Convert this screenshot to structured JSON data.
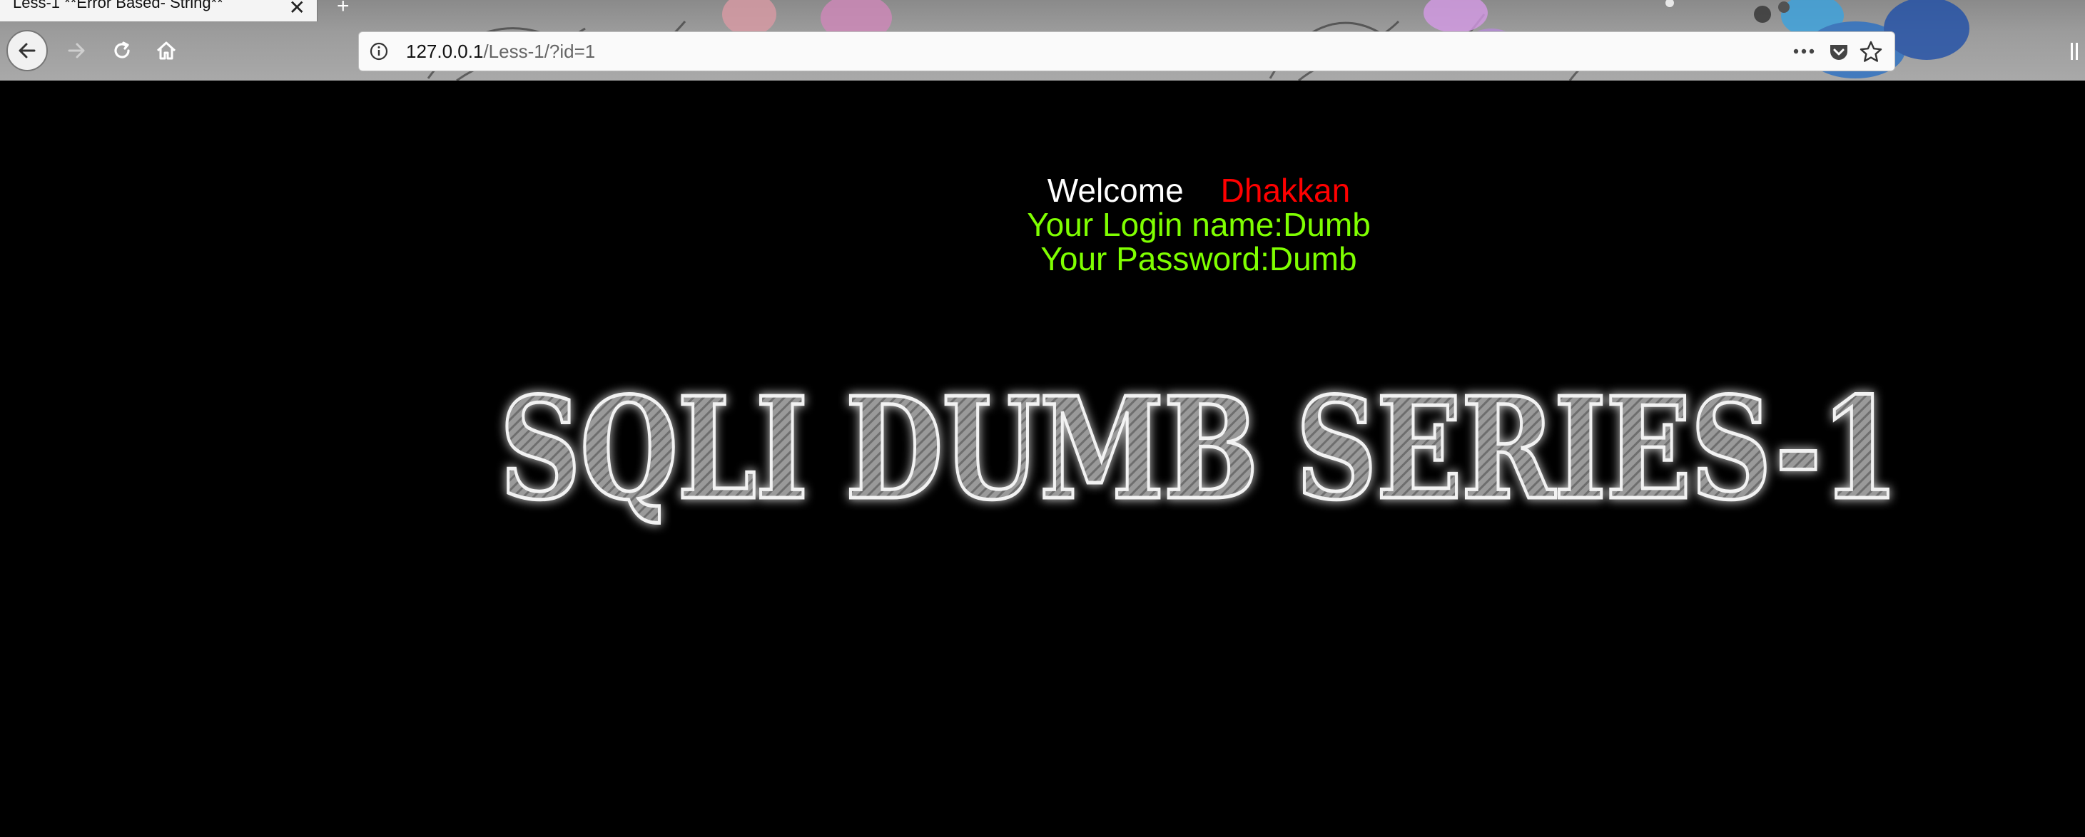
{
  "browser": {
    "tab_title": "Less-1 **Error Based- String**",
    "tab_close_glyph": "✕",
    "new_tab_glyph": "+",
    "url_host": "127.0.0.1",
    "url_path": "/Less-1/?id=1"
  },
  "page": {
    "welcome_word": "Welcome",
    "welcome_name": "Dhakkan",
    "login_line": "Your Login name:Dumb",
    "password_line": "Your Password:Dumb",
    "banner_text": "SQLI DUMB SERIES-1"
  },
  "colors": {
    "page_bg": "#000000",
    "welcome": "#ffffff",
    "name": "#ff0000",
    "credentials": "#7fff00"
  }
}
